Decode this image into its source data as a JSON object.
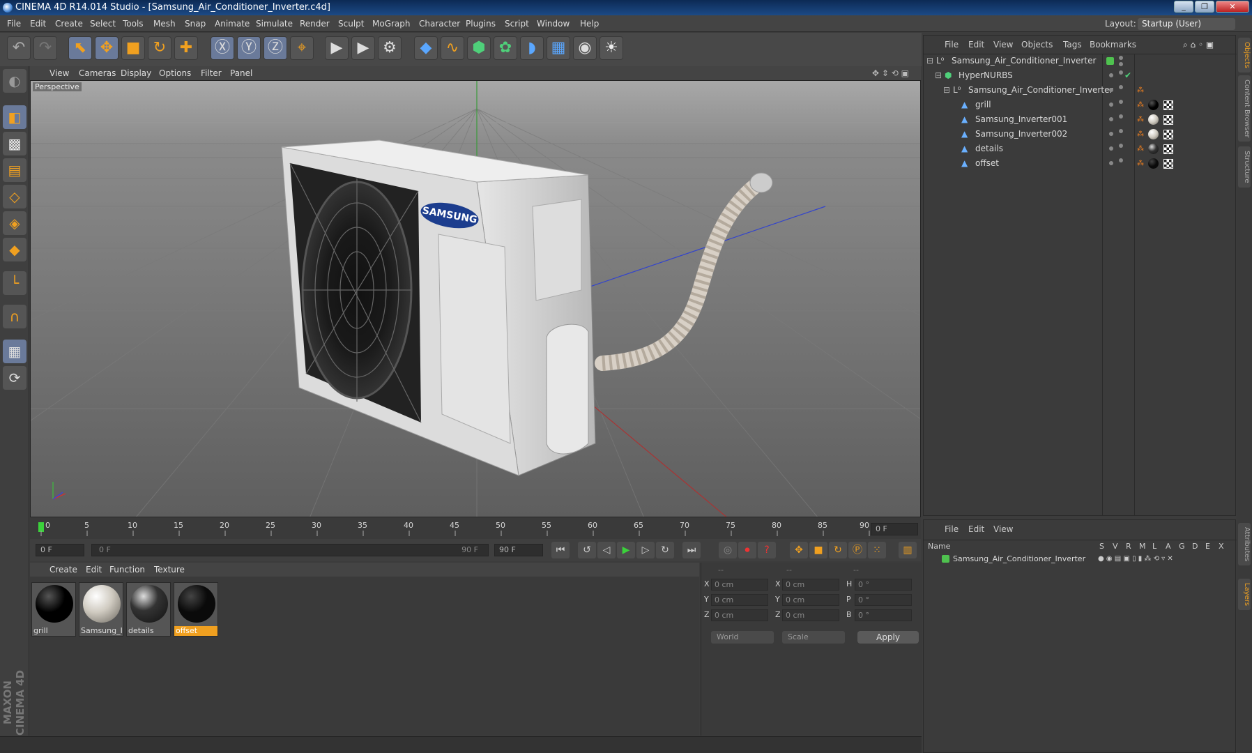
{
  "window": {
    "title": "CINEMA 4D R14.014 Studio - [Samsung_Air_Conditioner_Inverter.c4d]",
    "buttons": [
      "_",
      "❐",
      "✕"
    ]
  },
  "menubar": {
    "items": [
      "File",
      "Edit",
      "Create",
      "Select",
      "Tools",
      "Mesh",
      "Snap",
      "Animate",
      "Simulate",
      "Render",
      "Sculpt",
      "MoGraph",
      "Character",
      "Plugins",
      "Script",
      "Window",
      "Help"
    ],
    "layout_label": "Layout:",
    "layout_value": "Startup (User)"
  },
  "viewport": {
    "menu": [
      "View",
      "Cameras",
      "Display",
      "Options",
      "Filter",
      "Panel"
    ],
    "label": "Perspective",
    "brand_text": "SAMSUNG"
  },
  "timeline": {
    "ticks": [
      "0",
      "5",
      "10",
      "15",
      "20",
      "25",
      "30",
      "35",
      "40",
      "45",
      "50",
      "55",
      "60",
      "65",
      "70",
      "75",
      "80",
      "85",
      "90"
    ],
    "current_frame": "0 F"
  },
  "playback": {
    "start_field": "0 F",
    "range_start": "0 F",
    "range_end": "90 F",
    "end_field": "90 F"
  },
  "materials": {
    "menu": [
      "Create",
      "Edit",
      "Function",
      "Texture"
    ],
    "items": [
      {
        "name": "grill",
        "color": "#000000"
      },
      {
        "name": "Samsung_I",
        "color": "#cfcac0"
      },
      {
        "name": "details",
        "color": "#333333"
      },
      {
        "name": "offset",
        "color": "#0a0a0a",
        "selected": true
      }
    ]
  },
  "coords": {
    "headers": [
      "--",
      "--",
      "--"
    ],
    "rows": [
      {
        "a": "X",
        "av": "0 cm",
        "b": "X",
        "bv": "0 cm",
        "c": "H",
        "cv": "0 °"
      },
      {
        "a": "Y",
        "av": "0 cm",
        "b": "Y",
        "bv": "0 cm",
        "c": "P",
        "cv": "0 °"
      },
      {
        "a": "Z",
        "av": "0 cm",
        "b": "Z",
        "bv": "0 cm",
        "c": "B",
        "cv": "0 °"
      }
    ],
    "mode1": "World",
    "mode2": "Scale",
    "apply": "Apply"
  },
  "objects": {
    "menu": [
      "File",
      "Edit",
      "View",
      "Objects",
      "Tags",
      "Bookmarks"
    ],
    "tree": [
      {
        "name": "Samsung_Air_Conditioner_Inverter",
        "indent": 0
      },
      {
        "name": "HyperNURBS",
        "indent": 1
      },
      {
        "name": "Samsung_Air_Conditioner_Inverter",
        "indent": 2
      },
      {
        "name": "grill",
        "indent": 3
      },
      {
        "name": "Samsung_Inverter001",
        "indent": 3
      },
      {
        "name": "Samsung_Inverter002",
        "indent": 3
      },
      {
        "name": "details",
        "indent": 3
      },
      {
        "name": "offset",
        "indent": 3
      }
    ]
  },
  "layers": {
    "menu": [
      "File",
      "Edit",
      "View"
    ],
    "columns": [
      "Name",
      "S",
      "V",
      "R",
      "M",
      "L",
      "A",
      "G",
      "D",
      "E",
      "X"
    ],
    "rows": [
      "Samsung_Air_Conditioner_Inverter"
    ]
  },
  "sidetabs": [
    "Objects",
    "Content Browser",
    "Structure",
    "Attributes",
    "Layers"
  ],
  "maxon_logo": "MAXON CINEMA 4D"
}
